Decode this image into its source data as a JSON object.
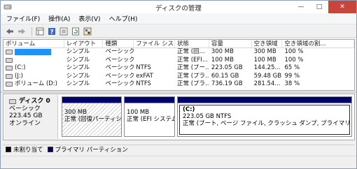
{
  "window": {
    "title": "ディスクの管理",
    "minimize": "—",
    "maximize": "□",
    "close": "✕"
  },
  "menu": [
    "ファイル(F)",
    "操作(A)",
    "表示(V)",
    "ヘルプ(H)"
  ],
  "toolbar": {
    "icons": [
      "back-arrow-icon",
      "forward-arrow-icon",
      "grid-view-icon",
      "help-icon",
      "list-view-icon",
      "refresh-icon",
      "properties-icon"
    ]
  },
  "volume_table": {
    "columns": [
      "ボリューム",
      "レイアウト",
      "種類",
      "ファイル シス...",
      "状態",
      "容量",
      "空き領域",
      "空き領域の割..."
    ],
    "rows": [
      {
        "volume": "",
        "layout": "シンプル",
        "type": "ベーシック",
        "fs": "",
        "status": "正常 (回...",
        "capacity": "300 MB",
        "free": "300 MB",
        "pct": "100 %"
      },
      {
        "volume": "",
        "layout": "シンプル",
        "type": "ベーシック",
        "fs": "",
        "status": "正常 (EFI...",
        "capacity": "100 MB",
        "free": "100 MB",
        "pct": "100 %"
      },
      {
        "volume": "(C:)",
        "layout": "シンプル",
        "type": "ベーシック",
        "fs": "NTFS",
        "status": "正常 (ブー...",
        "capacity": "223.05 GB",
        "free": "144.25...",
        "pct": "65 %"
      },
      {
        "volume": "(J:)",
        "layout": "シンプル",
        "type": "ベーシック",
        "fs": "exFAT",
        "status": "正常 (プラ...",
        "capacity": "60.15 GB",
        "free": "59.48 GB",
        "pct": "99 %"
      },
      {
        "volume": "ボリューム (D:)",
        "layout": "シンプル",
        "type": "ベーシック",
        "fs": "NTFS",
        "status": "正常 (プラ...",
        "capacity": "736.19 GB",
        "free": "281.54...",
        "pct": "38 %"
      }
    ]
  },
  "disk0": {
    "name": "ディスク 0",
    "type": "ベーシック",
    "size": "223.45 GB",
    "state": "オンライン",
    "partitions": [
      {
        "label": "",
        "size": "300 MB",
        "status": "正常 (回復パーティション)"
      },
      {
        "label": "",
        "size": "100 MB",
        "status": "正常 (EFI システム"
      },
      {
        "label": "(C:)",
        "size": "223.05 GB NTFS",
        "status": "正常 (ブート, ページ ファイル, クラッシュ ダンプ, プライマリ パー"
      }
    ]
  },
  "legend": {
    "unallocated": "未割り当て",
    "primary": "プライマリ パーティション",
    "unallocated_color": "#000000",
    "primary_color": "#00006e"
  },
  "colors": {
    "accent": "#1e90ff",
    "partition_bar": "#00006e",
    "close_button": "#c7453a"
  }
}
